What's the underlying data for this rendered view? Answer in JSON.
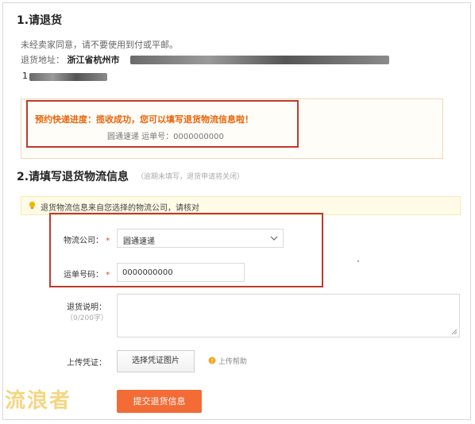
{
  "section1": {
    "title": "1.请退货",
    "notice": "未经卖家同意，请不要使用到付或平邮。",
    "address_label": "退货地址：",
    "address_prefix": "浙江省杭州市",
    "phone_prefix": "1"
  },
  "status": {
    "progress_text": "预约快递进度：揽收成功，您可以填写退货物流信息啦！",
    "carrier_line": "圆通速递 运单号：0000000000"
  },
  "section2": {
    "title": "2.请填写退货物流信息",
    "hint": "（逾期未填写，退货申请将关闭）"
  },
  "tip": {
    "text": "退货物流信息来自您选择的物流公司，请核对"
  },
  "form": {
    "carrier_label": "物流公司：",
    "carrier_required": "*",
    "carrier_value": "圆通速递",
    "tracking_label": "运单号码：",
    "tracking_required": "*",
    "tracking_value": "0000000000",
    "note_label": "退货说明：",
    "note_counter": "（0/200字）",
    "upload_label": "上传凭证：",
    "upload_button": "选择凭证图片",
    "upload_help": "上传帮助",
    "submit_button": "提交退货信息"
  },
  "watermark": {
    "text": "流浪者"
  },
  "colors": {
    "accent_orange": "#f36b35",
    "highlight_red": "#c0392b",
    "status_orange": "#e8650a"
  }
}
